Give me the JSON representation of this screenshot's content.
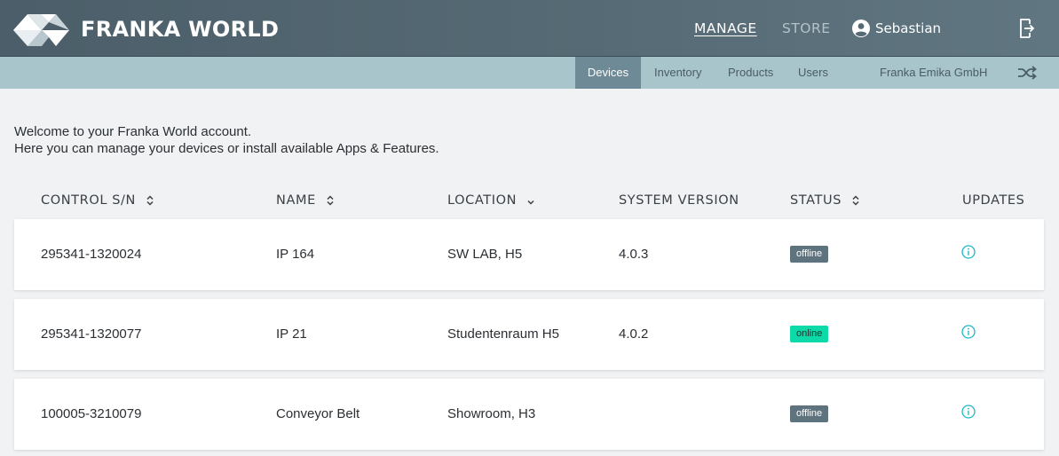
{
  "header": {
    "brand": "FRANKA WORLD",
    "nav": {
      "manage": "MANAGE",
      "store": "STORE"
    },
    "user": "Sebastian",
    "icons": {
      "logo": "franka-logo-icon",
      "user": "account-circle-icon",
      "logout": "logout-icon"
    }
  },
  "subnav": {
    "tabs": [
      "Devices",
      "Inventory",
      "Products",
      "Users"
    ],
    "active_tab": "Devices",
    "company": "Franka Emika GmbH",
    "switch_icon": "shuffle-icon"
  },
  "welcome": {
    "line1": "Welcome to your Franka World account.",
    "line2": "Here you can manage your devices or install available Apps & Features."
  },
  "table": {
    "columns": {
      "serial": "CONTROL S/N",
      "name": "NAME",
      "location": "LOCATION",
      "version": "SYSTEM VERSION",
      "status": "STATUS",
      "updates": "UPDATES"
    },
    "rows": [
      {
        "serial": "295341-1320024",
        "name": "IP 164",
        "location": "SW LAB, H5",
        "version": "4.0.3",
        "status": "offline"
      },
      {
        "serial": "295341-1320077",
        "name": "IP 21",
        "location": "Studentenraum H5",
        "version": "4.0.2",
        "status": "online"
      },
      {
        "serial": "100005-3210079",
        "name": "Conveyor Belt",
        "location": "Showroom, H3",
        "version": "",
        "status": "offline"
      }
    ]
  },
  "colors": {
    "topbar": "#566a75",
    "subbar": "#a9c5cc",
    "active_tab": "#6e8a96",
    "badge_offline": "#5e737d",
    "badge_online": "#0ed9a9",
    "info_icon": "#1fb8c6"
  }
}
